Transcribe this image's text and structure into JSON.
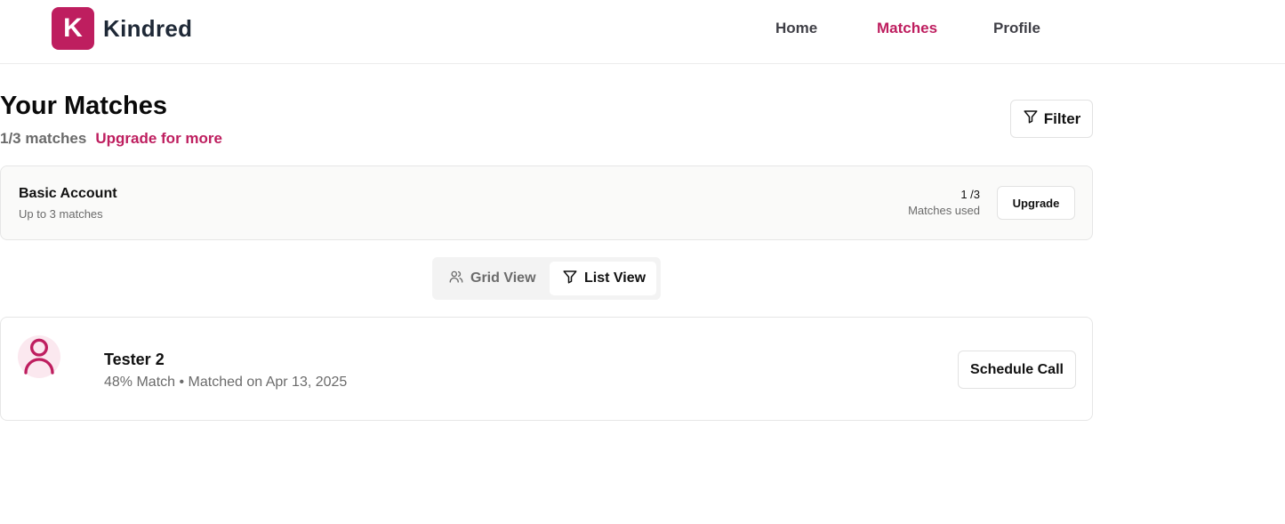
{
  "brand": {
    "logo_letter": "K",
    "name": "Kindred",
    "accent_color": "#be1e5f"
  },
  "nav": {
    "home": "Home",
    "matches": "Matches",
    "profile": "Profile",
    "active": "Matches"
  },
  "page": {
    "title": "Your Matches",
    "match_count": "1/3 matches",
    "upgrade_link": "Upgrade for more",
    "filter_label": "Filter",
    "filter_icon": "filter-icon"
  },
  "account": {
    "title": "Basic Account",
    "subtitle": "Up to 3 matches",
    "usage_count": "1 /3",
    "usage_label": "Matches used",
    "upgrade_button": "Upgrade"
  },
  "view_toggle": {
    "grid_label": "Grid View",
    "grid_icon": "users-icon",
    "list_label": "List View",
    "list_icon": "filter-icon",
    "selected": "List View"
  },
  "matches": [
    {
      "name": "Tester 2",
      "meta": "48% Match • Matched on Apr 13, 2025",
      "avatar_icon": "user-icon",
      "action_label": "Schedule Call"
    }
  ]
}
